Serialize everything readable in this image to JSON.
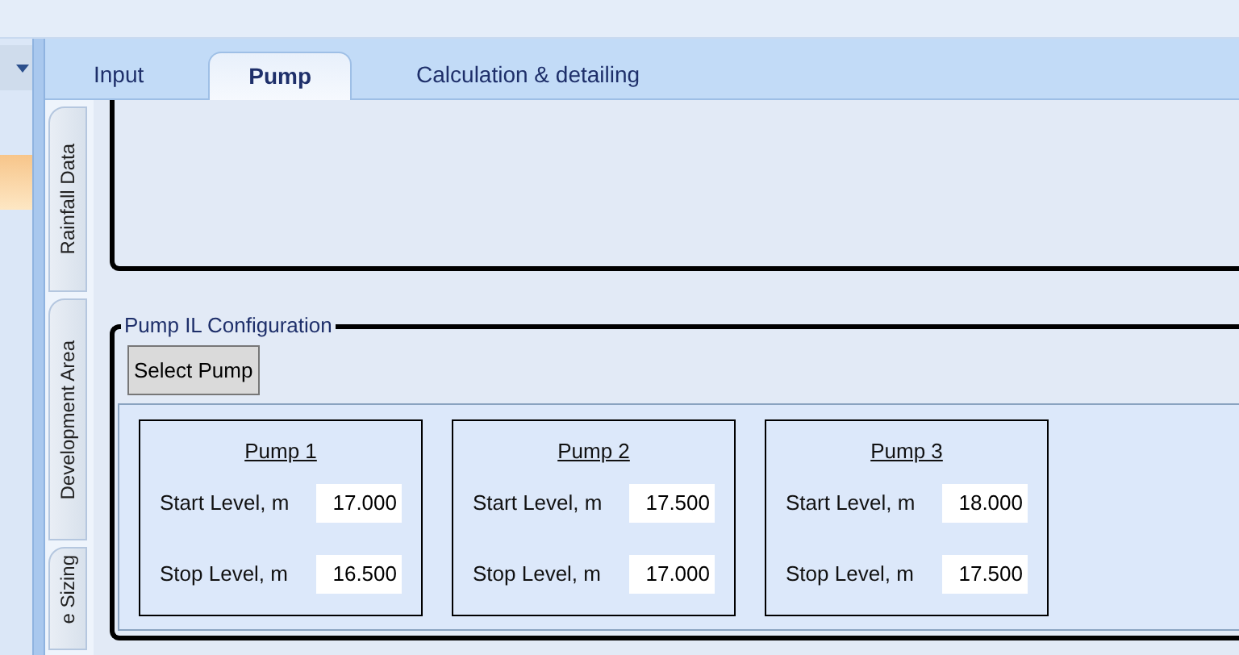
{
  "tabs": [
    {
      "label": "Input",
      "selected": false
    },
    {
      "label": "Pump",
      "selected": true
    },
    {
      "label": "Calculation & detailing",
      "selected": false
    }
  ],
  "side_tabs": [
    {
      "label": "Rainfall Data",
      "selected": false
    },
    {
      "label": "Development Area",
      "selected": false
    },
    {
      "label": "e Sizing",
      "selected": false
    }
  ],
  "pump_config": {
    "title": "Pump IL Configuration",
    "select_button": "Select Pump",
    "pumps": [
      {
        "title": "Pump 1",
        "start_label": "Start Level, m",
        "start_value": "17.000",
        "stop_label": "Stop Level, m",
        "stop_value": "16.500"
      },
      {
        "title": "Pump 2",
        "start_label": "Start Level, m",
        "start_value": "17.500",
        "stop_label": "Stop Level, m",
        "stop_value": "17.000"
      },
      {
        "title": "Pump 3",
        "start_label": "Start Level, m",
        "start_value": "18.000",
        "stop_label": "Stop Level, m",
        "stop_value": "17.500"
      }
    ]
  }
}
